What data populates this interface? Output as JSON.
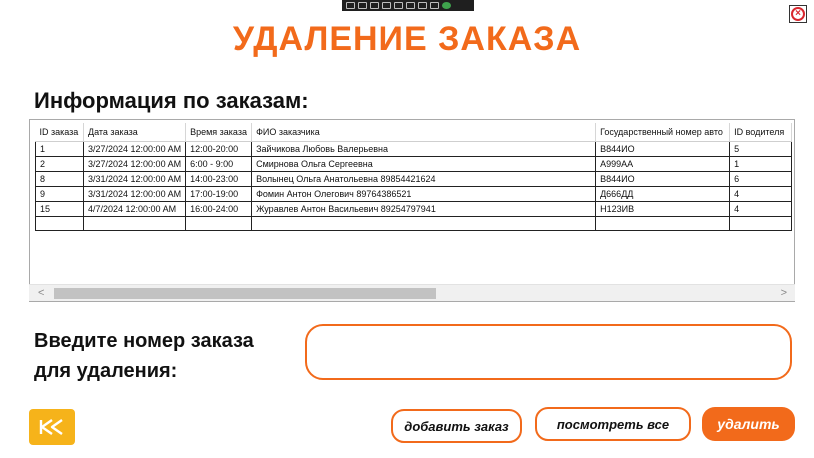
{
  "title": "УДАЛЕНИЕ ЗАКАЗА",
  "subtitle": "Информация по заказам:",
  "table": {
    "headers": [
      "ID заказа",
      "Дата заказа",
      "Время заказа",
      "ФИО заказчика",
      "Государственный номер авто",
      "ID водителя"
    ],
    "rows": [
      [
        "1",
        "3/27/2024 12:00:00 AM",
        "12:00-20:00",
        "Зайчикова Любовь Валерьевна",
        "В844ИО",
        "5"
      ],
      [
        "2",
        "3/27/2024 12:00:00 AM",
        "6:00 - 9:00",
        "Смирнова Ольга Сергеевна",
        "А999АА",
        "1"
      ],
      [
        "8",
        "3/31/2024 12:00:00 AM",
        "14:00-23:00",
        "Волынец Ольга Анатольевна 89854421624",
        "В844ИО",
        "6"
      ],
      [
        "9",
        "3/31/2024 12:00:00 AM",
        "17:00-19:00",
        "Фомин Антон Олегович 89764386521",
        "Д666ДД",
        "4"
      ],
      [
        "15",
        "4/7/2024 12:00:00 AM",
        "16:00-24:00",
        "Журавлев Антон Васильевич 89254797941",
        "Н123ИВ",
        "4"
      ]
    ]
  },
  "prompt": {
    "line1": "Введите номер заказа",
    "line2": "для удаления:"
  },
  "order_input": {
    "value": "",
    "placeholder": ""
  },
  "buttons": {
    "add": "добавить заказ",
    "view_all": "посмотреть все",
    "delete": "удалить",
    "back_icon": "rewind-icon",
    "close_icon": "close-icon"
  },
  "colors": {
    "accent": "#f26a1b",
    "back_button": "#f6b31a",
    "close": "#d9272e"
  }
}
